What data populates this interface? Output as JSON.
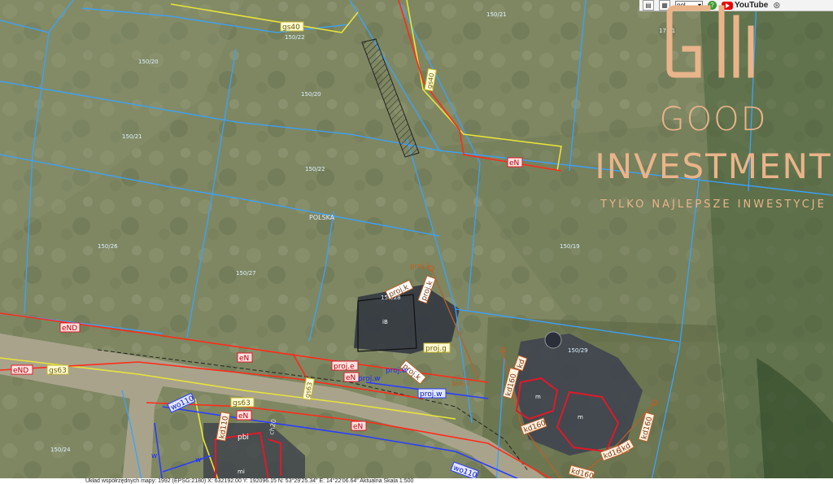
{
  "toolbar": {
    "language": "pol",
    "youtube_label": "YouTube"
  },
  "brand": {
    "name_line1": "GOOD",
    "name_line2": "INVESTMENT",
    "tagline": "TYLKO NAJLEPSZE INWESTYCJE",
    "color": "#e9b48a"
  },
  "map": {
    "region_label": "POLSKA",
    "plot_numbers": [
      "150/21",
      "150/22",
      "150/20",
      "150/21",
      "150/22",
      "150/26",
      "150/27",
      "150/19",
      "150/28",
      "150/29",
      "171/1",
      "150/24"
    ],
    "building_label_1": "iB",
    "building_label_2": "m",
    "building_label_3": "m",
    "building_label_4": "mi",
    "building_label_5": "pbi",
    "line_labels": {
      "gas_1": "gs40",
      "gas_2": "gs40",
      "gas_3": "gs63",
      "gas_4": "gs63",
      "gas_5": "gs63",
      "gas_6": "gs63",
      "electric_1": "eN",
      "electric_2": "eND",
      "electric_3": "eN",
      "electric_4": "eND",
      "electric_5": "eN",
      "electric_6": "eN",
      "electric_7": "eN",
      "water_1": "wo110",
      "water_2": "wo110",
      "water_3": "w",
      "water_4": "w",
      "sewer_1": "kd110",
      "sewer_2": "kd160",
      "sewer_3": "kd160",
      "sewer_4": "kd",
      "sewer_5": "kd160",
      "sewer_6": "kd160",
      "sewer_7": "kd160",
      "sewer_8": "kd",
      "proj_1": "proj.k",
      "proj_2": "proj.k",
      "proj_3": "proj.k",
      "proj_4": "proj.k",
      "proj_5": "proj.g",
      "proj_6": "proj.e",
      "proj_7": "proj.w",
      "proj_8": "proj.w",
      "proj_9": "proj.k",
      "misc_1": "ch20",
      "misc_2": "kd110",
      "misc_3": "dk"
    }
  },
  "statusbar": {
    "text": "Układ współrzędnych mapy: 1992 (EPSG:2180)  X: 632192.00  Y: 192096.15  N: 53°29'25.34\"  E: 14°22'06.64\"  Aktualna Skala 1:500"
  },
  "colors": {
    "parcel_line": "#3aa2ff",
    "electric": "#ff2a1a",
    "gas": "#e8e43a",
    "water": "#2a3cff",
    "sewer": "#a5582a",
    "building": "#e0192b"
  }
}
